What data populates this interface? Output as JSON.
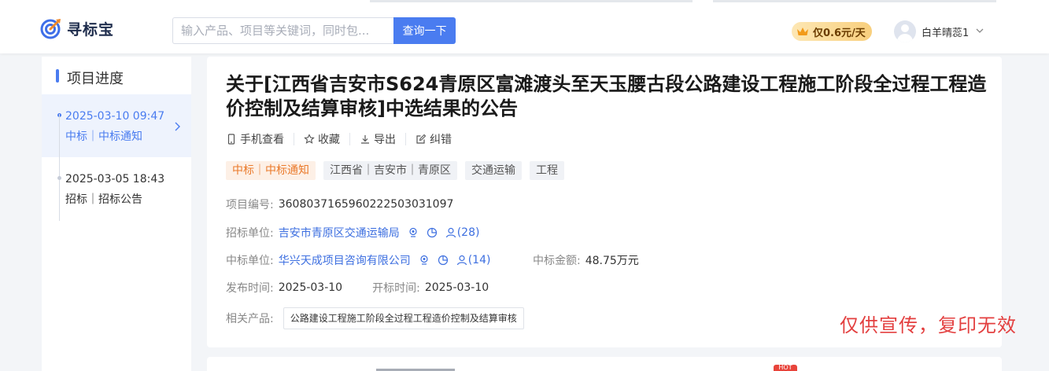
{
  "header": {
    "logo_text": "寻标宝",
    "search_placeholder": "输入产品、项目等关键词，同时包...",
    "search_button": "查询一下",
    "vip_label": "仅0.6元/天",
    "username": "白羊晴蕊1"
  },
  "progress": {
    "title": "项目进度",
    "items": [
      {
        "date": "2025-03-10 09:47",
        "type": "中标｜中标通知",
        "active": true
      },
      {
        "date": "2025-03-05 18:43",
        "type": "招标｜招标公告",
        "active": false
      }
    ]
  },
  "notice": {
    "title": "关于[江西省吉安市S624青原区富滩渡头至天玉腰古段公路建设工程施工阶段全过程工程造价控制及结算审核]中选结果的公告",
    "actions": [
      "手机查看",
      "收藏",
      "导出",
      "纠错"
    ],
    "tags": [
      "中标｜中标通知",
      "江西省｜吉安市｜青原区",
      "交通运输",
      "工程"
    ],
    "project_no_label": "项目编号:",
    "project_no": "36080371659602225030310​97",
    "tenderer_label": "招标单位:",
    "tenderer": "吉安市青原区交通运输局",
    "tenderer_count": "(28)",
    "winner_label": "中标单位:",
    "winner": "华兴天成项目咨询有限公司",
    "winner_count": "(14)",
    "amount_label": "中标金额:",
    "amount": "48.75万元",
    "publish_label": "发布时间:",
    "publish_date": "2025-03-10",
    "open_label": "开标时间:",
    "open_date": "2025-03-10",
    "product_label": "相关产品:",
    "product": "公路建设工程施工阶段全过程工程造价控制及结算审核",
    "watermark": "仅供宣传，复印无效"
  },
  "bottom": {
    "hot_badge": "HOT"
  },
  "colors": {
    "accent": "#4a7cf0",
    "tag_orange": "#ea7a2b",
    "watermark": "#e33f3f"
  }
}
